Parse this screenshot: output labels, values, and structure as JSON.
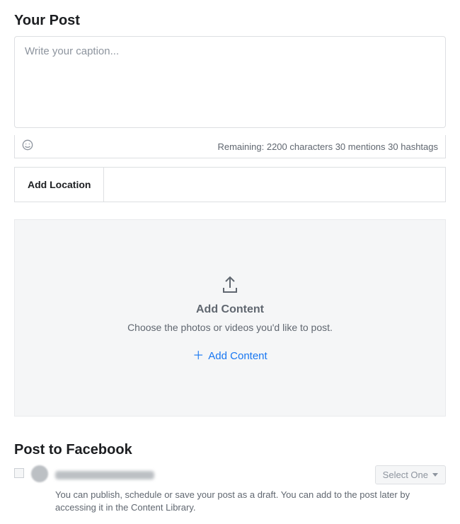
{
  "yourPost": {
    "title": "Your Post",
    "captionPlaceholder": "Write your caption...",
    "status": {
      "remainingLabel": "Remaining:",
      "characters": "2200 characters",
      "mentions": "30 mentions",
      "hashtags": "30 hashtags"
    },
    "addLocationLabel": "Add Location"
  },
  "contentPanel": {
    "heading": "Add Content",
    "sub": "Choose the photos or videos you'd like to post.",
    "addLinkLabel": "Add Content"
  },
  "postToFacebook": {
    "title": "Post to Facebook",
    "selectLabel": "Select One",
    "helpText": "You can publish, schedule or save your post as a draft. You can add to the post later by accessing it in the Content Library."
  }
}
